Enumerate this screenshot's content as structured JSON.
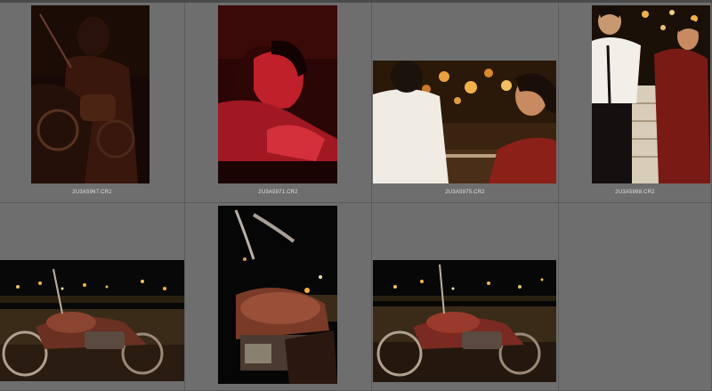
{
  "grid": {
    "thumbnails": [
      {
        "filename": "2U3A5967.CR2",
        "subject": "couple-motorcycle-dark"
      },
      {
        "filename": "2U3A5971.CR2",
        "subject": "woman-red-light-portrait"
      },
      {
        "filename": "2U3A5975.CR2",
        "subject": "couple-bokeh-railing"
      },
      {
        "filename": "2U3A5988.CR2",
        "subject": "couple-standing-railing"
      },
      {
        "filename": "",
        "subject": "motorcycle-city-lights"
      },
      {
        "filename": "",
        "subject": "motorcycle-handlebar-night"
      },
      {
        "filename": "",
        "subject": "motorcycle-city-night"
      }
    ]
  },
  "colors": {
    "background": "#6e6e6e",
    "label": "#e2e2e2",
    "warm_light": "#f2b24a"
  }
}
